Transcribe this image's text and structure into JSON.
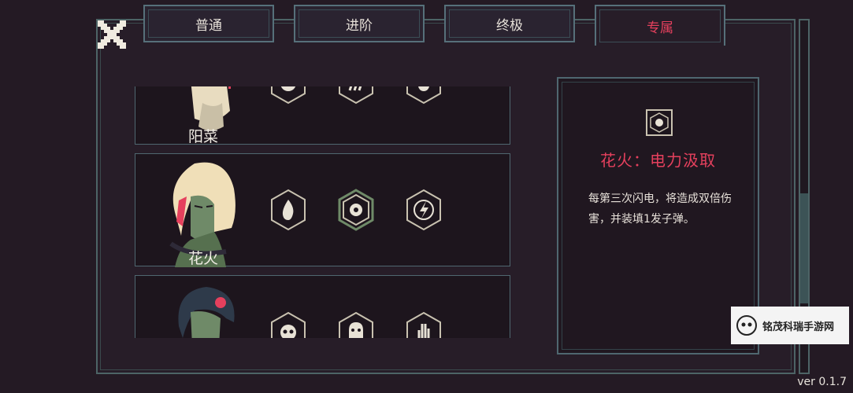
{
  "tabs": [
    {
      "label": "普通",
      "active": false
    },
    {
      "label": "进阶",
      "active": false
    },
    {
      "label": "终极",
      "active": false
    },
    {
      "label": "专属",
      "active": true
    }
  ],
  "characters": [
    {
      "name": "阳菜",
      "skills": [
        "skull-icon",
        "claw-icon",
        "paw-icon"
      ]
    },
    {
      "name": "花火",
      "skills": [
        "flame-icon",
        "orb-icon",
        "lightning-icon"
      ]
    },
    {
      "name": "",
      "skills": [
        "skull-icon",
        "ghost-icon",
        "hand-icon"
      ]
    }
  ],
  "detail": {
    "icon": "orb-icon",
    "title": "花火：电力汲取",
    "description": "每第三次闪电，将造成双倍伤害，并装填1发子弹。"
  },
  "watermark": {
    "text": "铭茂科瑞手游网"
  },
  "version": "ver 0.1.7",
  "colors": {
    "accent": "#e5405d",
    "border": "#4f6770",
    "background": "#241a24"
  }
}
